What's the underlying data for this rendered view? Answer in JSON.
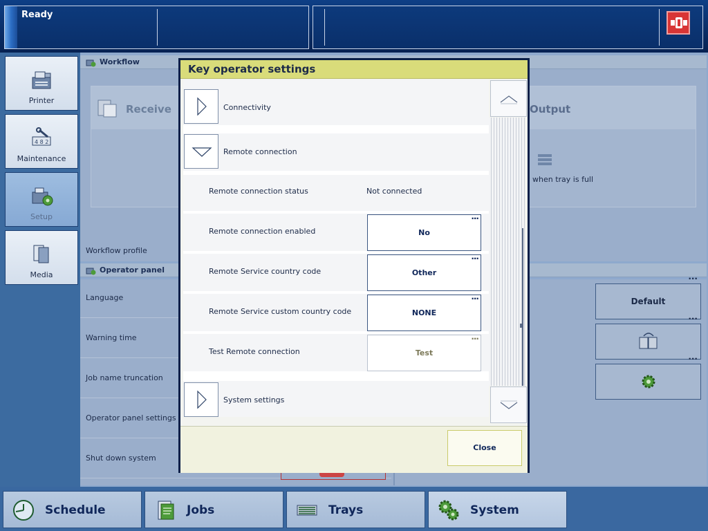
{
  "status": {
    "text": "Ready"
  },
  "nav": {
    "items": [
      {
        "label": "Printer",
        "icon": "printer-icon"
      },
      {
        "label": "Maintenance",
        "icon": "maintenance-icon"
      },
      {
        "label": "Setup",
        "icon": "setup-icon",
        "active": true
      },
      {
        "label": "Media",
        "icon": "media-icon"
      }
    ]
  },
  "workflow": {
    "title": "Workflow",
    "receive": "Receive",
    "output": "Output",
    "tray_text": "y when tray is full",
    "profile_label": "Workflow profile"
  },
  "operator_panel": {
    "title": "Operator panel",
    "rows": [
      "Language",
      "Warning time",
      "Job name truncation",
      "Operator panel settings",
      "Shut down system"
    ],
    "language_value": "Default"
  },
  "tabs": [
    {
      "label": "Schedule",
      "icon": "clock-icon"
    },
    {
      "label": "Jobs",
      "icon": "document-icon"
    },
    {
      "label": "Trays",
      "icon": "tray-icon"
    },
    {
      "label": "System",
      "icon": "gears-icon",
      "active": true
    }
  ],
  "dialog": {
    "title": "Key operator settings",
    "groups": {
      "connectivity": "Connectivity",
      "remote_connection": "Remote connection",
      "system_settings": "System settings"
    },
    "settings": {
      "status_label": "Remote connection status",
      "status_value": "Not connected",
      "enabled_label": "Remote connection enabled",
      "enabled_value": "No",
      "country_label": "Remote Service country code",
      "country_value": "Other",
      "custom_label": "Remote Service custom country code",
      "custom_value": "NONE",
      "test_label": "Test Remote connection",
      "test_value": "Test"
    },
    "more_indicator": "...",
    "close_label": "Close"
  },
  "colors": {
    "dialog_title_bg": "#d9dc7a",
    "top_bar": "#0a2d66",
    "alert": "#d83535"
  }
}
